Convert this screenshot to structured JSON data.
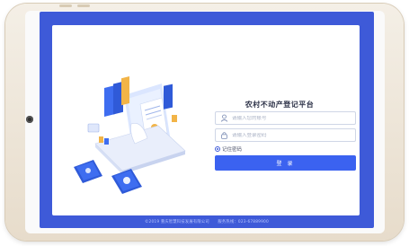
{
  "login": {
    "title": "农村不动产登记平台",
    "username_placeholder": "请输入您的账号",
    "password_placeholder": "请输入登录密码",
    "remember_label": "记住密码",
    "submit_label": "登 录",
    "icons": {
      "user": "user-icon",
      "lock": "lock-icon"
    }
  },
  "footer": {
    "copyright": "©2019 重庆智慧科技发展有限公司",
    "hotline": "服务热线：023-67889900"
  },
  "colors": {
    "screen_bg": "#3e5ad8",
    "button": "#3b62f0",
    "tablet_frame": "#efe7da"
  }
}
